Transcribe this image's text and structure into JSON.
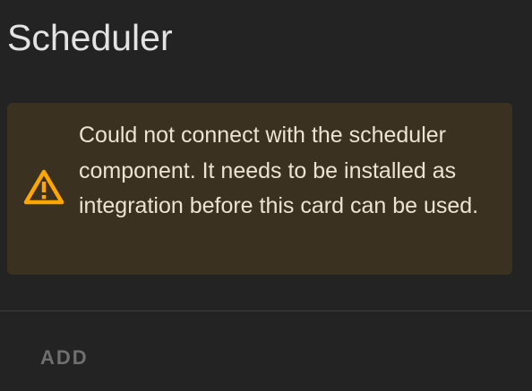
{
  "card": {
    "title": "Scheduler"
  },
  "alert": {
    "type": "warning",
    "icon": "warning-triangle-icon",
    "message": "Could not connect with the scheduler component. It needs to be installed as integration before this card can be used.",
    "colors": {
      "background": "#3a3120",
      "icon": "#ffa600",
      "text": "#ece3d3"
    }
  },
  "actions": {
    "add_label": "ADD"
  }
}
